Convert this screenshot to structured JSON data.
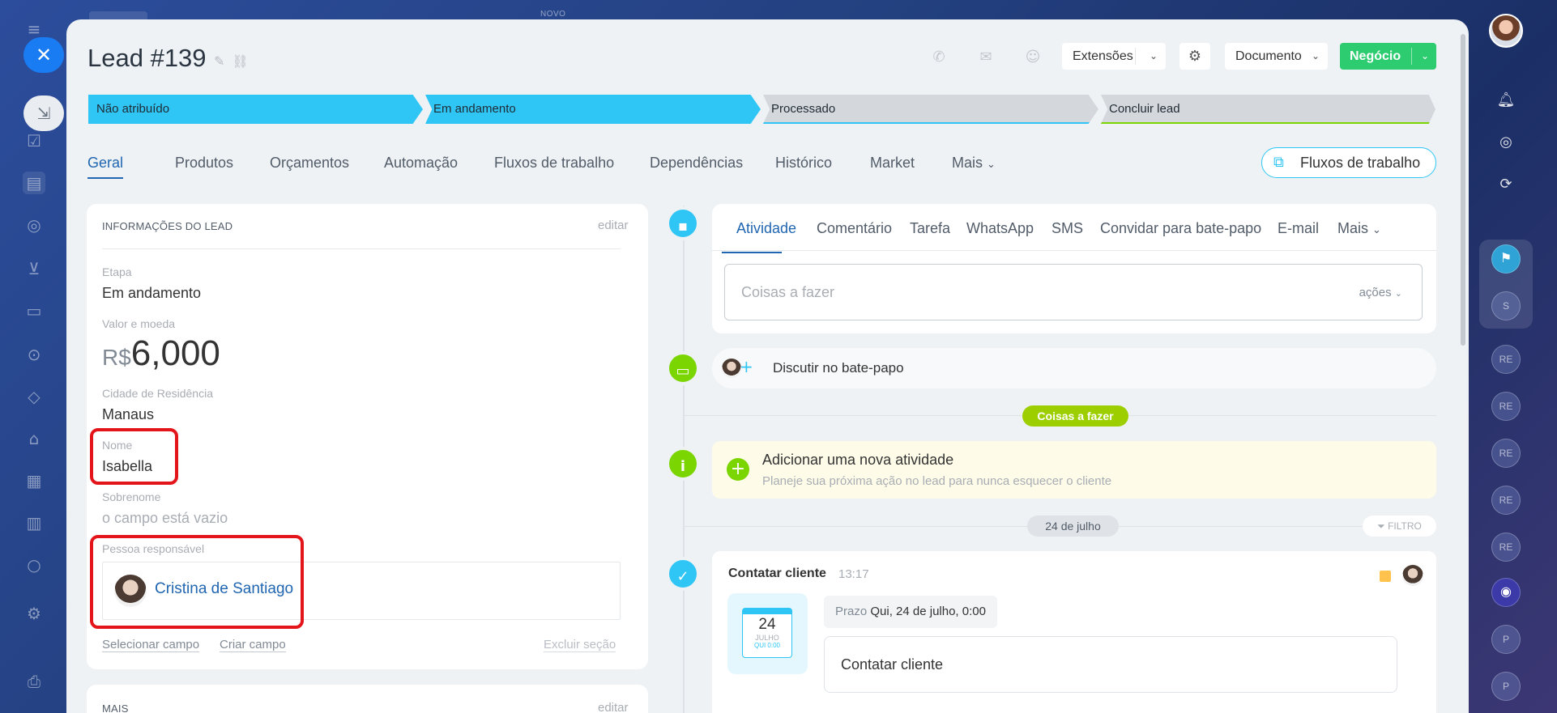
{
  "background": {
    "top_label": "NOVO"
  },
  "panel": {
    "title": "Lead #139",
    "header_buttons": {
      "extensions": "Extensões",
      "document": "Documento",
      "deal": "Negócio"
    },
    "stages": [
      {
        "label": "Não atribuído",
        "state": "active"
      },
      {
        "label": "Em andamento",
        "state": "active"
      },
      {
        "label": "Processado",
        "state": "pending"
      },
      {
        "label": "Concluir lead",
        "state": "final"
      }
    ],
    "tabs": [
      "Geral",
      "Produtos",
      "Orçamentos",
      "Automação",
      "Fluxos de trabalho",
      "Dependências",
      "Histórico",
      "Market",
      "Mais"
    ],
    "workflows_button": "Fluxos de trabalho"
  },
  "lead_info": {
    "section_title": "INFORMAÇÕES DO LEAD",
    "edit": "editar",
    "stage_label": "Etapa",
    "stage_value": "Em andamento",
    "amount_label": "Valor e moeda",
    "currency": "R$",
    "amount": "6,000",
    "city_label": "Cidade de Residência",
    "city_value": "Manaus",
    "name_label": "Nome",
    "name_value": "Isabella",
    "surname_label": "Sobrenome",
    "surname_value": "o campo está vazio",
    "responsible_label": "Pessoa responsável",
    "responsible_name": "Cristina de Santiago",
    "select_field": "Selecionar campo",
    "create_field": "Criar campo",
    "delete_section": "Excluir seção"
  },
  "more_section": {
    "title": "MAIS",
    "edit": "editar"
  },
  "activity": {
    "tabs": [
      "Atividade",
      "Comentário",
      "Tarefa",
      "WhatsApp",
      "SMS",
      "Convidar para bate-papo",
      "E-mail",
      "Mais"
    ],
    "todo_placeholder": "Coisas a fazer",
    "actions": "ações",
    "discuss": "Discutir no bate-papo",
    "todo_badge": "Coisas a fazer",
    "add_title": "Adicionar uma nova atividade",
    "add_sub": "Planeje sua próxima ação no lead para nunca esquecer o cliente",
    "date_badge": "24 de julho",
    "filter": "FILTRO",
    "task_title": "Contatar cliente",
    "task_time": "13:17",
    "cal_day": "24",
    "cal_month": "JULHO",
    "cal_sub": "QUI 0:00",
    "deadline_label": "Prazo",
    "deadline_value": "Qui, 24 de julho, 0:00",
    "task_text": "Contatar cliente"
  },
  "right_rail": {
    "chips": [
      "S",
      "RE",
      "RE",
      "RE",
      "RE",
      "RE",
      "P",
      "P"
    ]
  },
  "colors": {
    "accent": "#2fc6f6",
    "link": "#2066b0",
    "success": "#2ecc71",
    "highlight": "#e3151b",
    "timeline_green": "#7bd500"
  }
}
